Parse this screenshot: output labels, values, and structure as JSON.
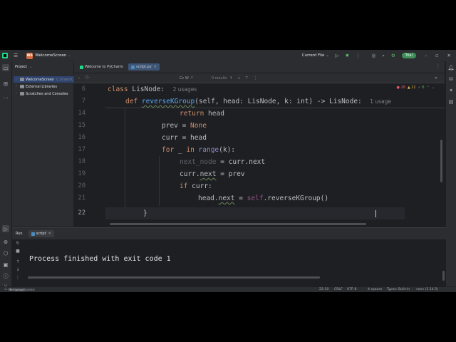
{
  "titlebar": {
    "project_badge": "WS",
    "project_name": "WelcomeScreen",
    "run_config": "Current File",
    "trial": "Trial"
  },
  "project_panel": {
    "title": "Project",
    "items": [
      {
        "label": "WelcomeScreen",
        "extra": "C:\\Users\\"
      },
      {
        "label": "External Libraries"
      },
      {
        "label": "Scratches and Consoles"
      }
    ]
  },
  "tabs": [
    {
      "label": "Welcome to PyCharm"
    },
    {
      "label": "script.py"
    }
  ],
  "findbar": {
    "query_placeholder": "Q-",
    "options": "Cc W .*",
    "results": "0 results"
  },
  "inspections": {
    "errors": "28",
    "warnings": "11",
    "typos": "6"
  },
  "code": {
    "sticky": [
      {
        "ln": "6",
        "class_kw": "class",
        "name": "LisNode:",
        "hint": "2 usages"
      },
      {
        "ln": "7",
        "def_kw": "def",
        "name": "reverseKGroup",
        "args": "(self, head: LisNode, k: int) -> LisNode:",
        "hint": "1 usage"
      }
    ],
    "lines": [
      {
        "ln": "14",
        "text": "return head"
      },
      {
        "ln": "15",
        "text": "prev = None"
      },
      {
        "ln": "16",
        "text": "curr = head"
      },
      {
        "ln": "17",
        "text": "for _ in range(k):"
      },
      {
        "ln": "18",
        "text": "next_node = curr.next"
      },
      {
        "ln": "19",
        "text": "curr.next = prev"
      },
      {
        "ln": "20",
        "text": "if curr:"
      },
      {
        "ln": "21",
        "text": "head.next = self.reverseKGroup()"
      },
      {
        "ln": "22",
        "text": "}"
      }
    ]
  },
  "run": {
    "title": "Run",
    "tab": "script",
    "output": "Process finished with exit code 1"
  },
  "status": {
    "breadcrumb_project": "WelcomeScreen",
    "breadcrumb_file": "script.py",
    "position": "22:10",
    "line_sep": "CRLF",
    "encoding": "UTF-8",
    "indent": "4 spaces",
    "types": "Types: Built-in",
    "interpreter": "venv (3.14.5)"
  }
}
